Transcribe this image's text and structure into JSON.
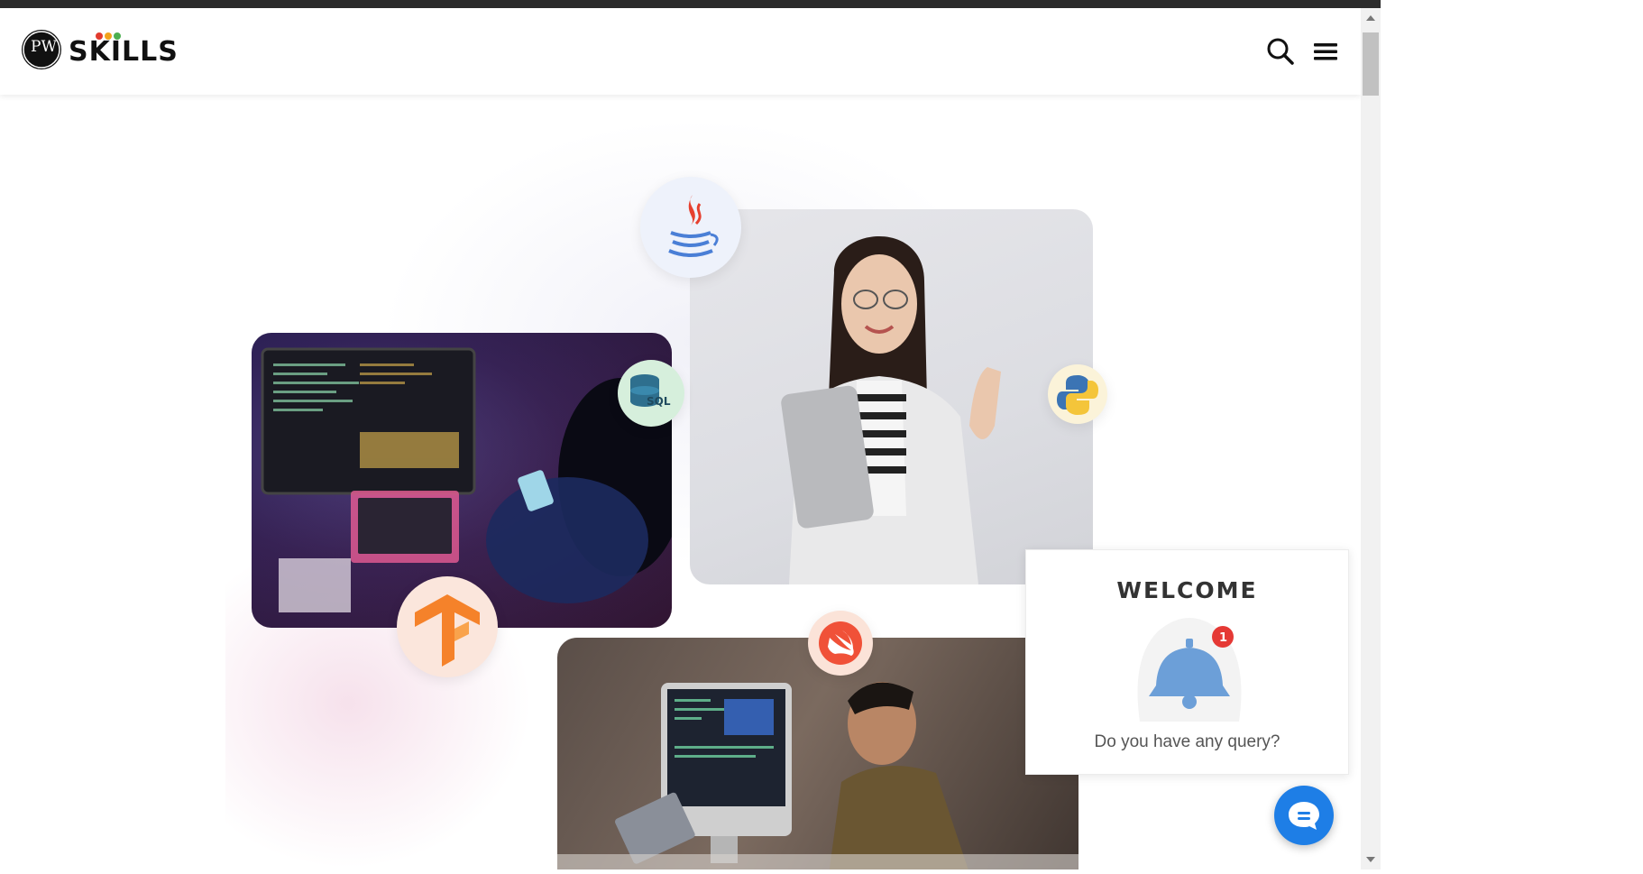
{
  "brand": {
    "logo_text": "SKILLS",
    "logo_monogram": "PW",
    "dot_colors": [
      "#e23b2e",
      "#f2a31b",
      "#4caf50"
    ]
  },
  "header": {
    "search_icon": "search-icon",
    "menu_icon": "hamburger-menu-icon"
  },
  "hero": {
    "badges": [
      "java-icon",
      "sql-icon",
      "python-icon",
      "tensorflow-icon",
      "swift-icon"
    ],
    "photos": [
      "developer-at-monitors",
      "smiling-woman-with-laptop",
      "developer-typing-at-desk"
    ],
    "badge_sql_label": "SQL"
  },
  "welcome_popup": {
    "title": "WELCOME",
    "notification_count": "1",
    "query_text": "Do you have any query?"
  },
  "chat": {
    "icon": "chat-bubble-icon",
    "color": "#1e7ee6"
  },
  "colors": {
    "topbar": "#2b2b2b",
    "accent": "#1e7ee6",
    "bell": "#6c9fd8",
    "badge_red": "#e53935"
  }
}
